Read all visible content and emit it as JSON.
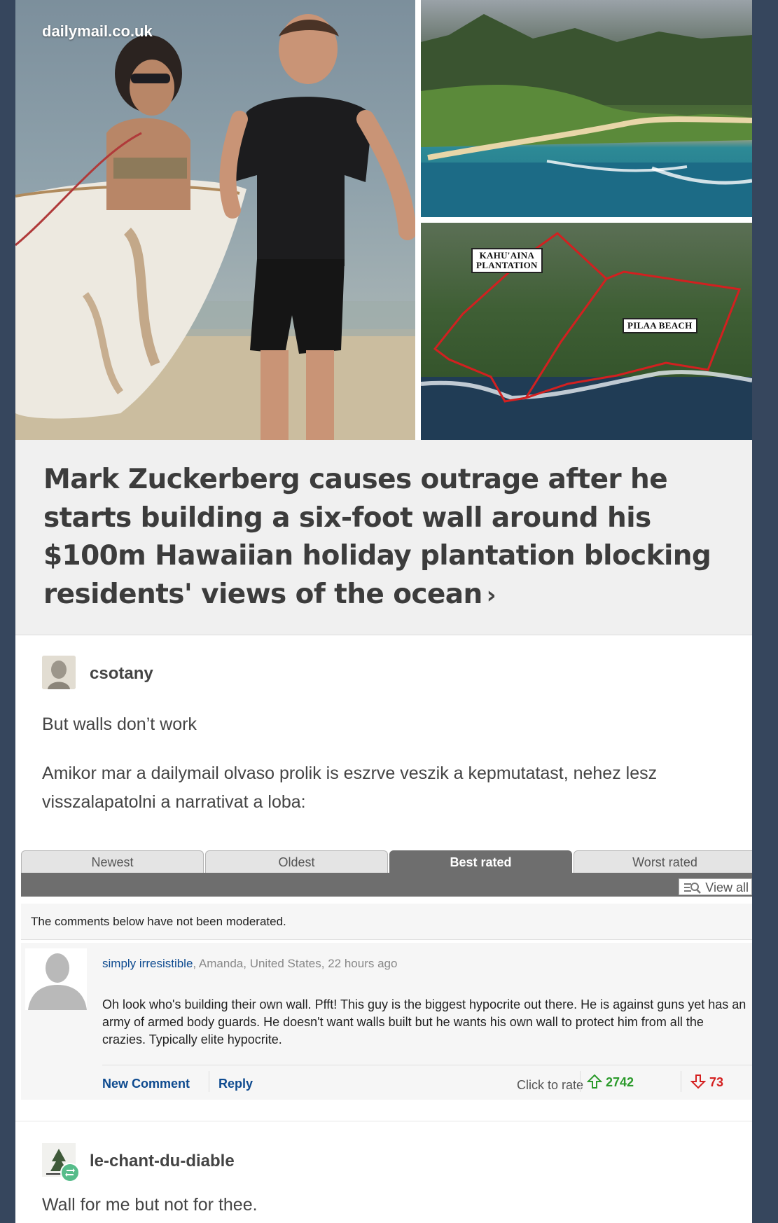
{
  "source_watermark": "dailymail.co.uk",
  "map_labels": {
    "label_1_line_1": "KAHU'AINA",
    "label_1_line_2": "PLANTATION",
    "label_2": "PILAA BEACH"
  },
  "headline": "Mark Zuckerberg causes outrage after he starts building a six-foot wall around his $100m Hawaiian holiday plantation blocking residents' views of the ocean",
  "headline_chevron": "›",
  "reblog_1": {
    "username": "csotany",
    "paragraph_1": "But walls don’t work",
    "paragraph_2": "Amikor mar a dailymail olvaso prolik is eszrve veszik a kepmutatast, nehez lesz visszalapatolni a narrativat a loba:"
  },
  "comments_widget": {
    "tabs": [
      "Newest",
      "Oldest",
      "Best rated",
      "Worst rated"
    ],
    "active_tab": "Best rated",
    "view_all": "View all",
    "moderation_note": "The comments below have not been moderated.",
    "comment": {
      "author": "simply irresistible",
      "meta": ", Amanda, United States, 22 hours ago",
      "body": "Oh look who's building their own wall. Pfft! This guy is the biggest hypocrite out there. He is against guns yet has an army of armed body guards. He doesn't want walls built but he wants his own wall to protect him from all the crazies. Typically elite hypocrite.",
      "new_comment": "New Comment",
      "reply": "Reply",
      "rate_label": "Click to rate",
      "upvotes": "2742",
      "downvotes": "73"
    }
  },
  "reblog_2": {
    "username": "le-chant-du-diable",
    "paragraph_1": "Wall for me but not for thee."
  },
  "colors": {
    "background": "#36465d",
    "link_blue": "#0d4a8f",
    "upvote_green": "#2b9a2b",
    "downvote_red": "#d42020",
    "reblog_badge": "#56bc8a"
  }
}
